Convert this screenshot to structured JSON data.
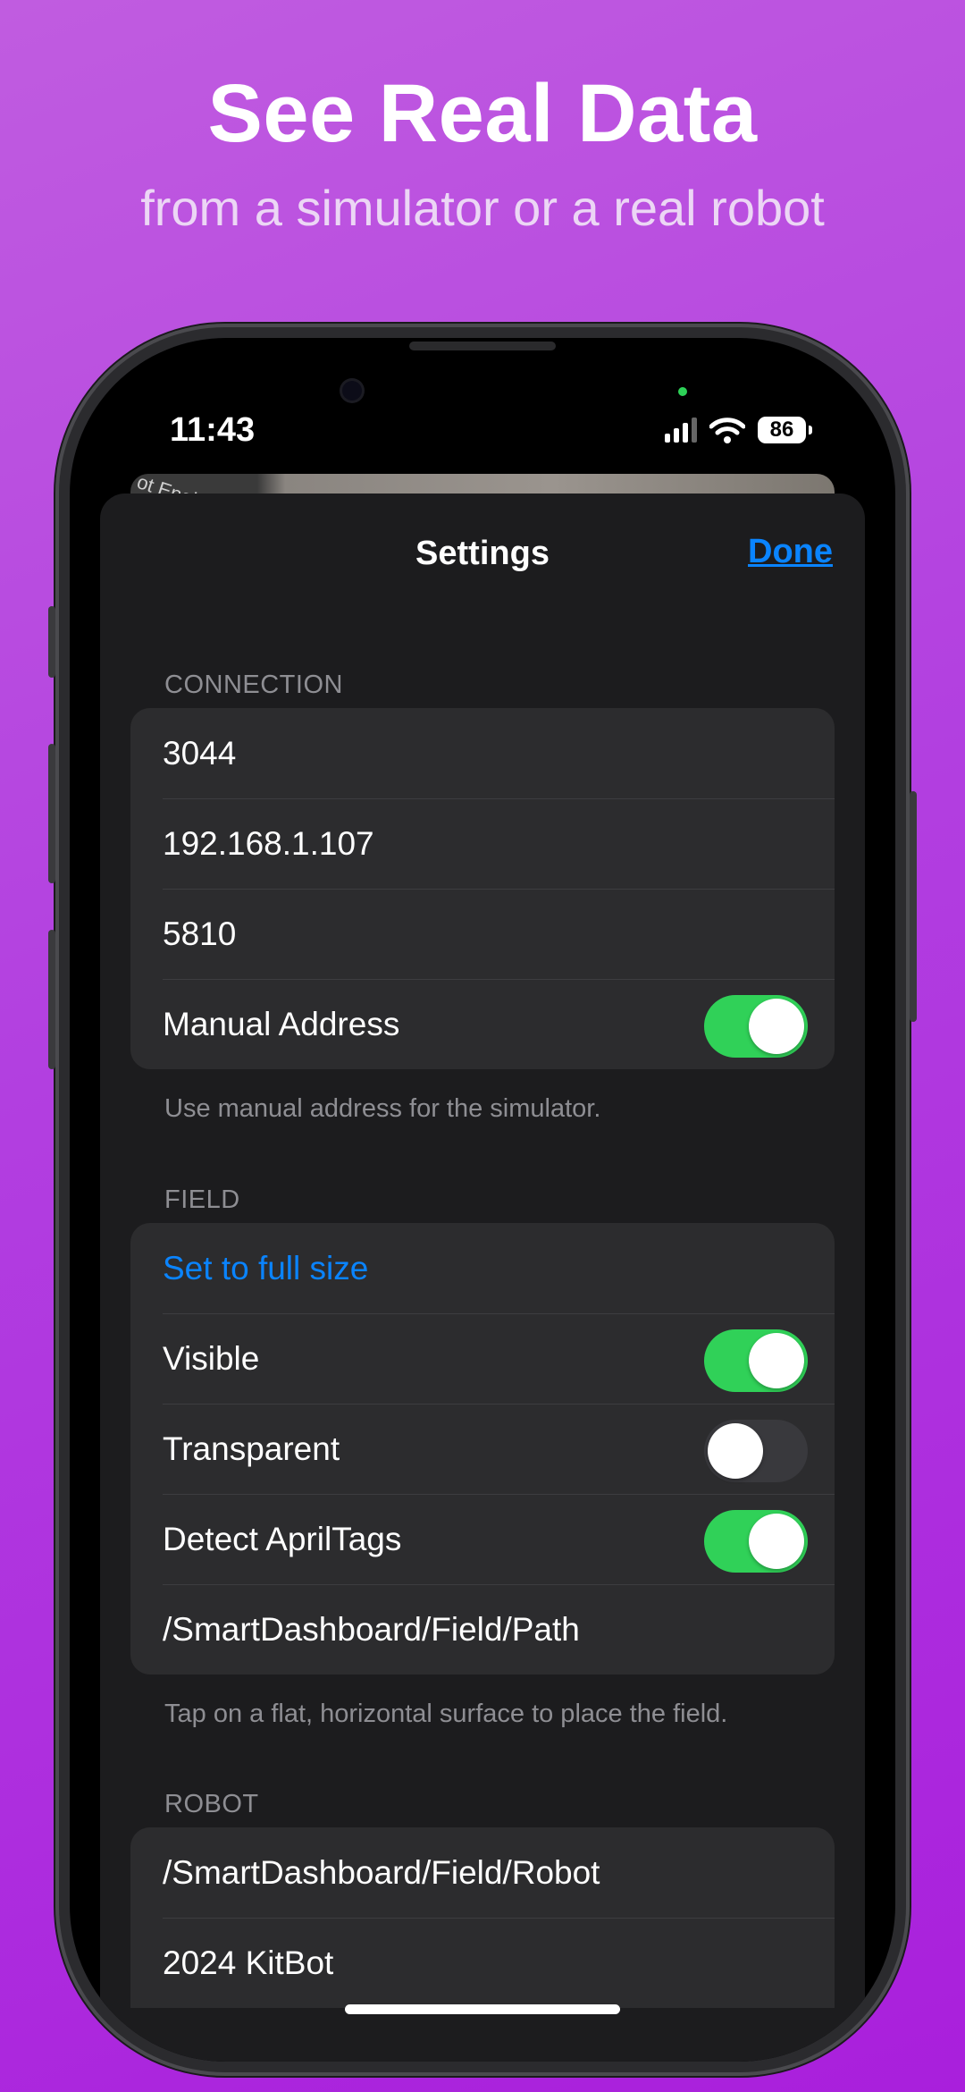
{
  "promo": {
    "headline": "See Real Data",
    "subheadline": "from a simulator or a real robot"
  },
  "status_bar": {
    "time": "11:43",
    "battery": "86",
    "icons": [
      "cellular-signal-icon",
      "wifi-icon",
      "battery-icon"
    ]
  },
  "background_card": {
    "partial_text": "ot Enabl"
  },
  "sheet": {
    "title": "Settings",
    "done_label": "Done"
  },
  "connection": {
    "header": "CONNECTION",
    "team_number": "3044",
    "ip_address": "192.168.1.107",
    "port": "5810",
    "manual_address_label": "Manual Address",
    "manual_address_on": true,
    "footer": "Use manual address for the simulator."
  },
  "field": {
    "header": "FIELD",
    "set_full_size_label": "Set to full size",
    "visible_label": "Visible",
    "visible_on": true,
    "transparent_label": "Transparent",
    "transparent_on": false,
    "detect_apriltags_label": "Detect AprilTags",
    "detect_apriltags_on": true,
    "path_topic": "/SmartDashboard/Field/Path",
    "footer": "Tap on a flat, horizontal surface to place the field."
  },
  "robot": {
    "header": "ROBOT",
    "robot_topic": "/SmartDashboard/Field/Robot",
    "robot_model": "2024 KitBot"
  },
  "colors": {
    "accent_blue": "#0a84ff",
    "toggle_on_green": "#30d158",
    "background_purple": "#b23fe0"
  }
}
